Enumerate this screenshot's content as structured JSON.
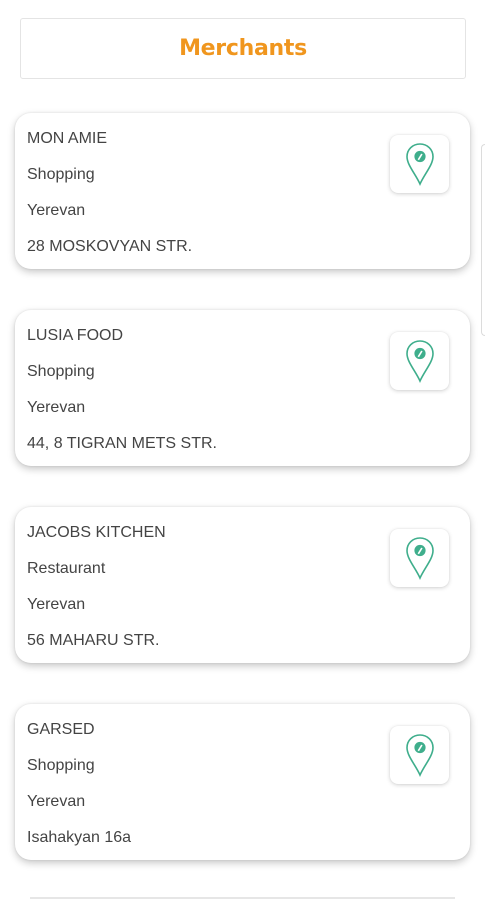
{
  "header": {
    "title": "Merchants"
  },
  "colors": {
    "accent": "#f0961e",
    "pin": "#3fae8c",
    "text": "#444444"
  },
  "merchants": [
    {
      "name": "MON  AMIE",
      "category": "Shopping",
      "city": "Yerevan",
      "address": "28 MOSKOVYAN STR.",
      "icon": "map-pin-icon"
    },
    {
      "name": "LUSIA FOOD",
      "category": "Shopping",
      "city": "Yerevan",
      "address": "44, 8 TIGRAN METS STR.",
      "icon": "map-pin-icon"
    },
    {
      "name": "JACOBS KITCHEN",
      "category": "Restaurant",
      "city": "Yerevan",
      "address": "56 MAHARU STR.",
      "icon": "map-pin-icon"
    },
    {
      "name": "GARSED",
      "category": "Shopping",
      "city": "Yerevan",
      "address": "Isahakyan 16a",
      "icon": "map-pin-icon"
    }
  ]
}
